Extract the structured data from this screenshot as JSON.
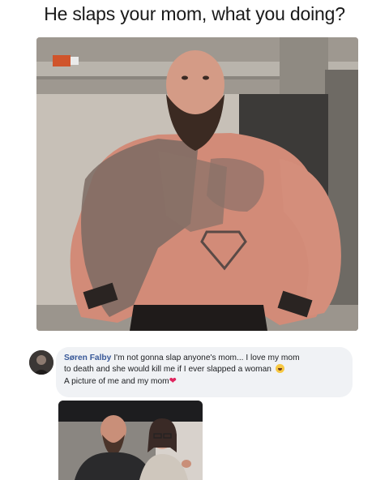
{
  "headline": "He slaps your mom, what you doing?",
  "photo": {
    "icon": "muscular-tattooed-man-photo"
  },
  "comment": {
    "author": "Søren Falby",
    "line1": "I'm not gonna slap anyone's mom... I love my mom",
    "line2": "to death and she would kill me if I ever slapped a woman",
    "line3": "A picture of me and my mom",
    "emoji": "laughing-emoji",
    "heart": "❤",
    "heart_color": "#e0245e",
    "author_color": "#385898",
    "bubble_color": "#f0f2f5"
  },
  "attached_photo": {
    "icon": "man-and-mother-photo"
  }
}
